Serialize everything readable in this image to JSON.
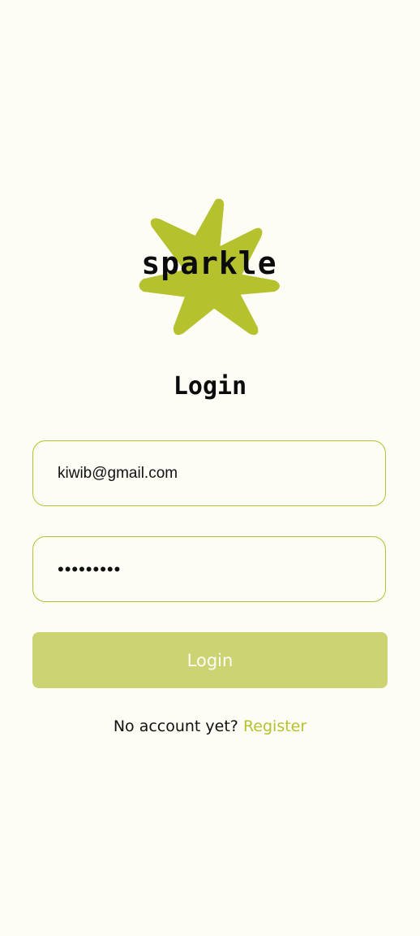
{
  "brand": {
    "name": "sparkle",
    "accent_color": "#b5c22e",
    "icon": "sparkle-star-icon"
  },
  "page": {
    "title": "Login"
  },
  "form": {
    "email_value": "kiwib@gmail.com",
    "password_value": "•••••••••",
    "submit_label": "Login",
    "submit_button_color": "#cbd373"
  },
  "footer": {
    "prompt_text": "No account yet?",
    "register_label": "Register"
  }
}
